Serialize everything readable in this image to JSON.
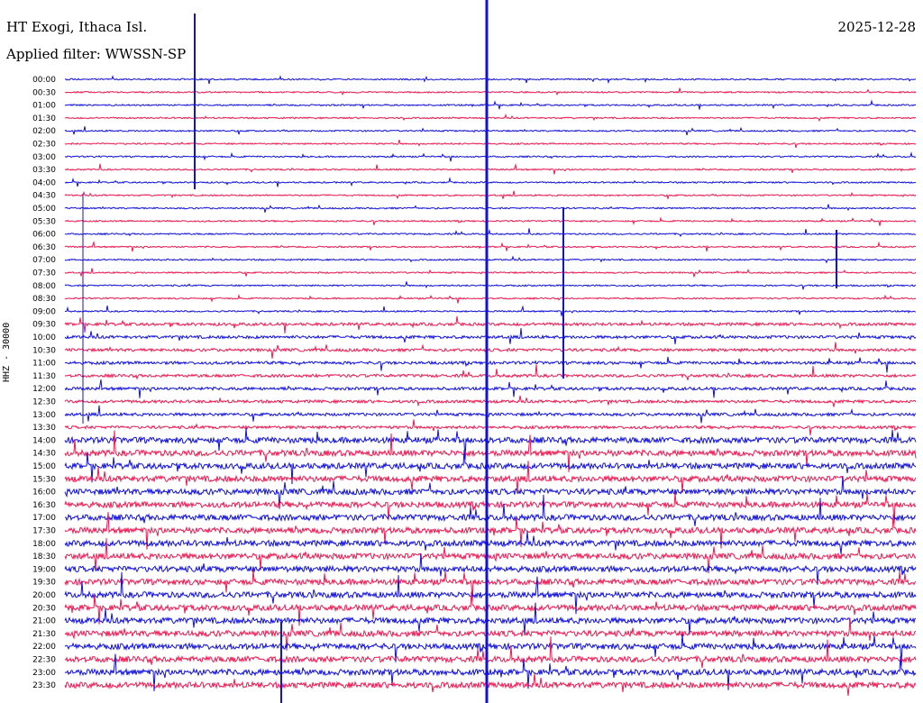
{
  "header": {
    "station": "HT Exogi, Ithaca Isl.",
    "filter": "Applied filter: WWSSN-SP",
    "date": "2025-12-28"
  },
  "axis": {
    "ylabel": "HHZ - 30000"
  },
  "colors": {
    "trace_a": "#1010e0",
    "trace_b": "#f01850"
  },
  "rows": [
    "00:00",
    "00:30",
    "01:00",
    "01:30",
    "02:00",
    "02:30",
    "03:00",
    "03:30",
    "04:00",
    "04:30",
    "05:00",
    "05:30",
    "06:00",
    "06:30",
    "07:00",
    "07:30",
    "08:00",
    "08:30",
    "09:00",
    "09:30",
    "10:00",
    "10:30",
    "11:00",
    "11:30",
    "12:00",
    "12:30",
    "13:00",
    "13:30",
    "14:00",
    "14:30",
    "15:00",
    "15:30",
    "16:00",
    "16:30",
    "17:00",
    "17:30",
    "18:00",
    "18:30",
    "19:00",
    "19:30",
    "20:00",
    "20:30",
    "21:00",
    "21:30",
    "22:00",
    "22:30",
    "23:00",
    "23:30"
  ]
}
